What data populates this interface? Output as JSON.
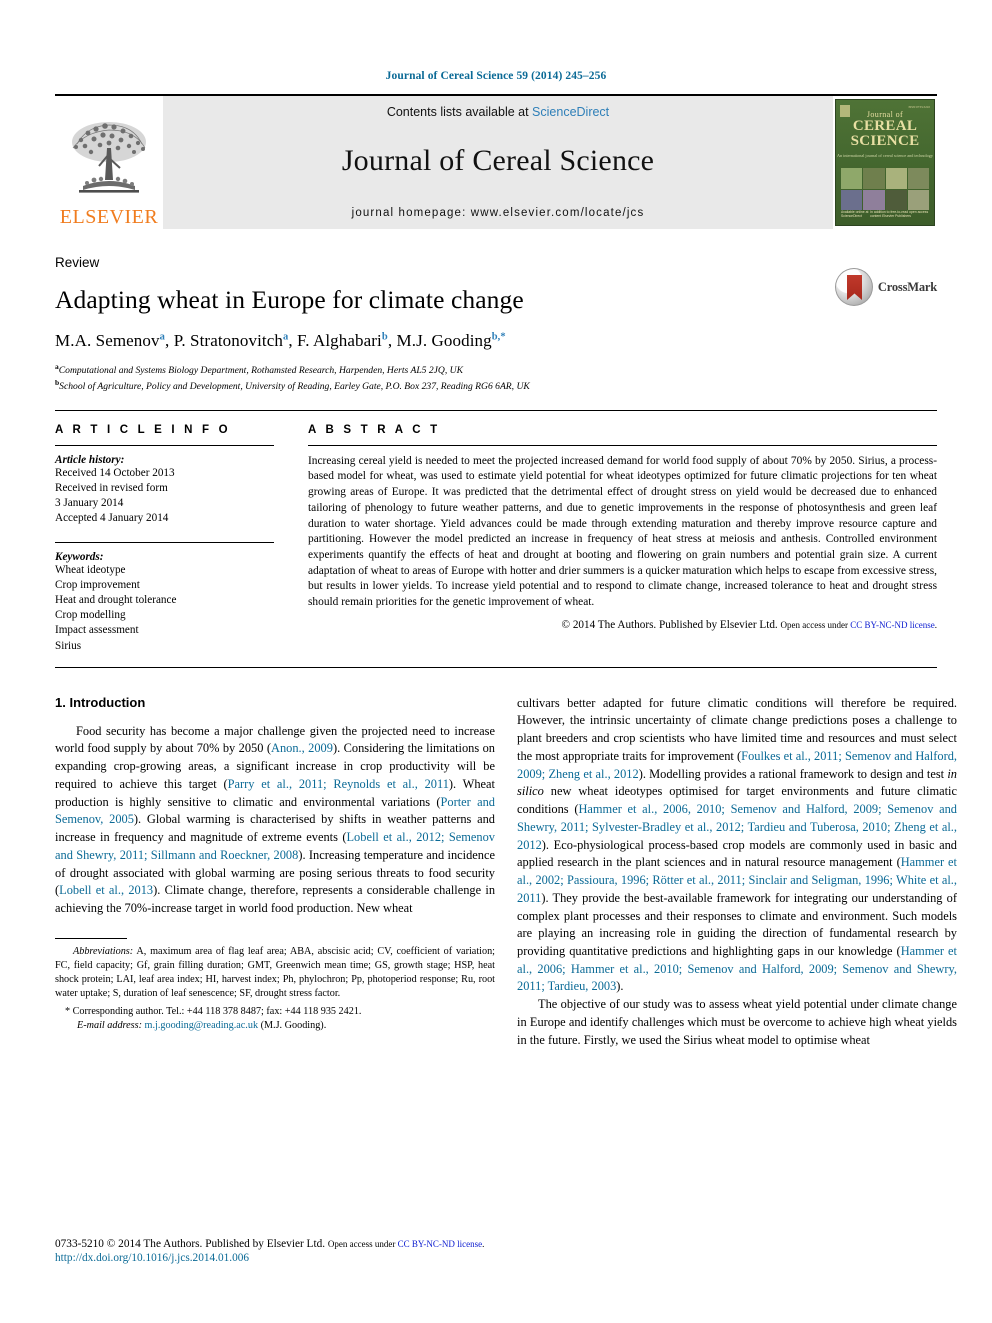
{
  "running_head": "Journal of Cereal Science 59 (2014) 245–256",
  "masthead": {
    "publisher_logo_text": "ELSEVIER",
    "contents_prefix": "Contents lists available at ",
    "contents_link": "ScienceDirect",
    "journal_title": "Journal of Cereal Science",
    "homepage_text": "journal homepage: www.elsevier.com/locate/jcs",
    "cover": {
      "line1": "Journal of",
      "line2a": "CEREAL",
      "line2b": "SCIENCE",
      "tagline": "An international journal of cereal science and technology",
      "issn": "ISSN 0733-5210",
      "foot_left": "Available online at\nScienceDirect",
      "foot_right": "In addition to free-to-read\nopen access content\nElsevier Publishers"
    }
  },
  "article": {
    "type_label": "Review",
    "title": "Adapting wheat in Europe for climate change",
    "authors": [
      {
        "name": "M.A. Semenov",
        "sup": "a",
        "sep": ", "
      },
      {
        "name": "P. Stratonovitch",
        "sup": "a",
        "sep": ", "
      },
      {
        "name": "F. Alghabari",
        "sup": "b",
        "sep": ", "
      },
      {
        "name": "M.J. Gooding",
        "sup": "b,*",
        "sep": ""
      }
    ],
    "affiliations": [
      {
        "mark": "a",
        "text": "Computational and Systems Biology Department, Rothamsted Research, Harpenden, Herts AL5 2JQ, UK"
      },
      {
        "mark": "b",
        "text": "School of Agriculture, Policy and Development, University of Reading, Earley Gate, P.O. Box 237, Reading RG6 6AR, UK"
      }
    ],
    "crossmark_label": "CrossMark"
  },
  "article_info": {
    "heading": "A R T I C L E   I N F O",
    "history_label": "Article history:",
    "history": [
      "Received 14 October 2013",
      "Received in revised form",
      "3 January 2014",
      "Accepted 4 January 2014"
    ],
    "keywords_label": "Keywords:",
    "keywords": [
      "Wheat ideotype",
      "Crop improvement",
      "Heat and drought tolerance",
      "Crop modelling",
      "Impact assessment",
      "Sirius"
    ]
  },
  "abstract": {
    "heading": "A B S T R A C T",
    "text": "Increasing cereal yield is needed to meet the projected increased demand for world food supply of about 70% by 2050. Sirius, a process-based model for wheat, was used to estimate yield potential for wheat ideotypes optimized for future climatic projections for ten wheat growing areas of Europe. It was predicted that the detrimental effect of drought stress on yield would be decreased due to enhanced tailoring of phenology to future weather patterns, and due to genetic improvements in the response of photosynthesis and green leaf duration to water shortage. Yield advances could be made through extending maturation and thereby improve resource capture and partitioning. However the model predicted an increase in frequency of heat stress at meiosis and anthesis. Controlled environment experiments quantify the effects of heat and drought at booting and flowering on grain numbers and potential grain size. A current adaptation of wheat to areas of Europe with hotter and drier summers is a quicker maturation which helps to escape from excessive stress, but results in lower yields. To increase yield potential and to respond to climate change, increased tolerance to heat and drought stress should remain priorities for the genetic improvement of wheat.",
    "copyright_main": "© 2014 The Authors. Published by Elsevier Ltd.",
    "copyright_small": "Open access under ",
    "copyright_link": "CC BY-NC-ND license",
    "copyright_tail": "."
  },
  "body": {
    "section_number_title": "1.  Introduction",
    "left_paragraph_1": {
      "segments": [
        {
          "t": "Food security has become a major challenge given the projected need to increase world food supply by about 70% by 2050 (",
          "c": "k"
        },
        {
          "t": "Anon., 2009",
          "c": "l"
        },
        {
          "t": "). Considering the limitations on expanding crop-growing areas, a significant increase in crop productivity will be required to achieve this target (",
          "c": "k"
        },
        {
          "t": "Parry et al., 2011; Reynolds et al., 2011",
          "c": "l"
        },
        {
          "t": "). Wheat production is highly sensitive to climatic and environmental variations (",
          "c": "k"
        },
        {
          "t": "Porter and Semenov, 2005",
          "c": "l"
        },
        {
          "t": "). Global warming is characterised by shifts in weather patterns and increase in frequency and magnitude of extreme events (",
          "c": "k"
        },
        {
          "t": "Lobell et al., 2012; Semenov and Shewry, 2011; Sillmann and Roeckner, 2008",
          "c": "l"
        },
        {
          "t": "). Increasing temperature and incidence of drought associated with global warming are posing serious threats to food security (",
          "c": "k"
        },
        {
          "t": "Lobell et al., 2013",
          "c": "l"
        },
        {
          "t": "). Climate change, therefore, represents a considerable challenge in achieving the 70%-increase target in world food production. New wheat ",
          "c": "k"
        }
      ]
    },
    "right_paragraph_1": {
      "segments": [
        {
          "t": "cultivars better adapted for future climatic conditions will therefore be required. However, the intrinsic uncertainty of climate change predictions poses a challenge to plant breeders and crop scientists who have limited time and resources and must select the most appropriate traits for improvement (",
          "c": "k"
        },
        {
          "t": "Foulkes et al., 2011; Semenov and Halford, 2009; Zheng et al., 2012",
          "c": "l"
        },
        {
          "t": "). Modelling provides a rational framework to design and test ",
          "c": "k"
        },
        {
          "t": "in silico",
          "c": "i"
        },
        {
          "t": " new wheat ideotypes optimised for target environments and future climatic conditions (",
          "c": "k"
        },
        {
          "t": "Hammer et al., 2006, 2010; Semenov and Halford, 2009; Semenov and Shewry, 2011; Sylvester-Bradley et al., 2012; Tardieu and Tuberosa, 2010; Zheng et al., 2012",
          "c": "l"
        },
        {
          "t": "). Eco-physiological process-based crop models are commonly used in basic and applied research in the plant sciences and in natural resource management (",
          "c": "k"
        },
        {
          "t": "Hammer et al., 2002; Passioura, 1996; Rötter et al., 2011; Sinclair and Seligman, 1996; White et al., 2011",
          "c": "l"
        },
        {
          "t": "). They provide the best-available framework for integrating our understanding of complex plant processes and their responses to climate and environment. Such models are playing an increasing role in guiding the direction of fundamental research by providing quantitative predictions and highlighting gaps in our knowledge (",
          "c": "k"
        },
        {
          "t": "Hammer et al., 2006; Hammer et al., 2010; Semenov and Halford, 2009; Semenov and Shewry, 2011; Tardieu, 2003",
          "c": "l"
        },
        {
          "t": ").",
          "c": "k"
        }
      ]
    },
    "right_paragraph_2": {
      "text": "The objective of our study was to assess wheat yield potential under climate change in Europe and identify challenges which must be overcome to achieve high wheat yields in the future. Firstly, we used the Sirius wheat model to optimise wheat"
    }
  },
  "footnotes": {
    "abbrev_label": "Abbreviations:",
    "abbrev_text": " A, maximum area of flag leaf area; ABA, abscisic acid; CV, coefficient of variation; FC, field capacity; Gf, grain filling duration; GMT, Greenwich mean time; GS, growth stage; HSP, heat shock protein; LAI, leaf area index; HI, harvest index; Ph, phylochron; Pp, photoperiod response; Ru, root water uptake; S, duration of leaf senescence; SF, drought stress factor.",
    "corresponding": "* Corresponding author. Tel.: +44 118 378 8487; fax: +44 118 935 2421.",
    "email_label": "E-mail address:",
    "email": "m.j.gooding@reading.ac.uk",
    "email_tail": " (M.J. Gooding)."
  },
  "page_footer": {
    "issn_copyright": "0733-5210 © 2014 The Authors. Published by Elsevier Ltd.",
    "open_access_small": "Open access under ",
    "license_link": "CC BY-NC-ND license",
    "license_tail": ".",
    "doi": "http://dx.doi.org/10.1016/j.jcs.2014.01.006"
  },
  "colors": {
    "link_teal": "#0b6a96",
    "link_blue": "#1020d0",
    "sciencedirect": "#2e7fb8",
    "elsevier_orange": "#f07c1e",
    "banner_gray": "#e9e9e9",
    "cover_green": "#43662e"
  }
}
